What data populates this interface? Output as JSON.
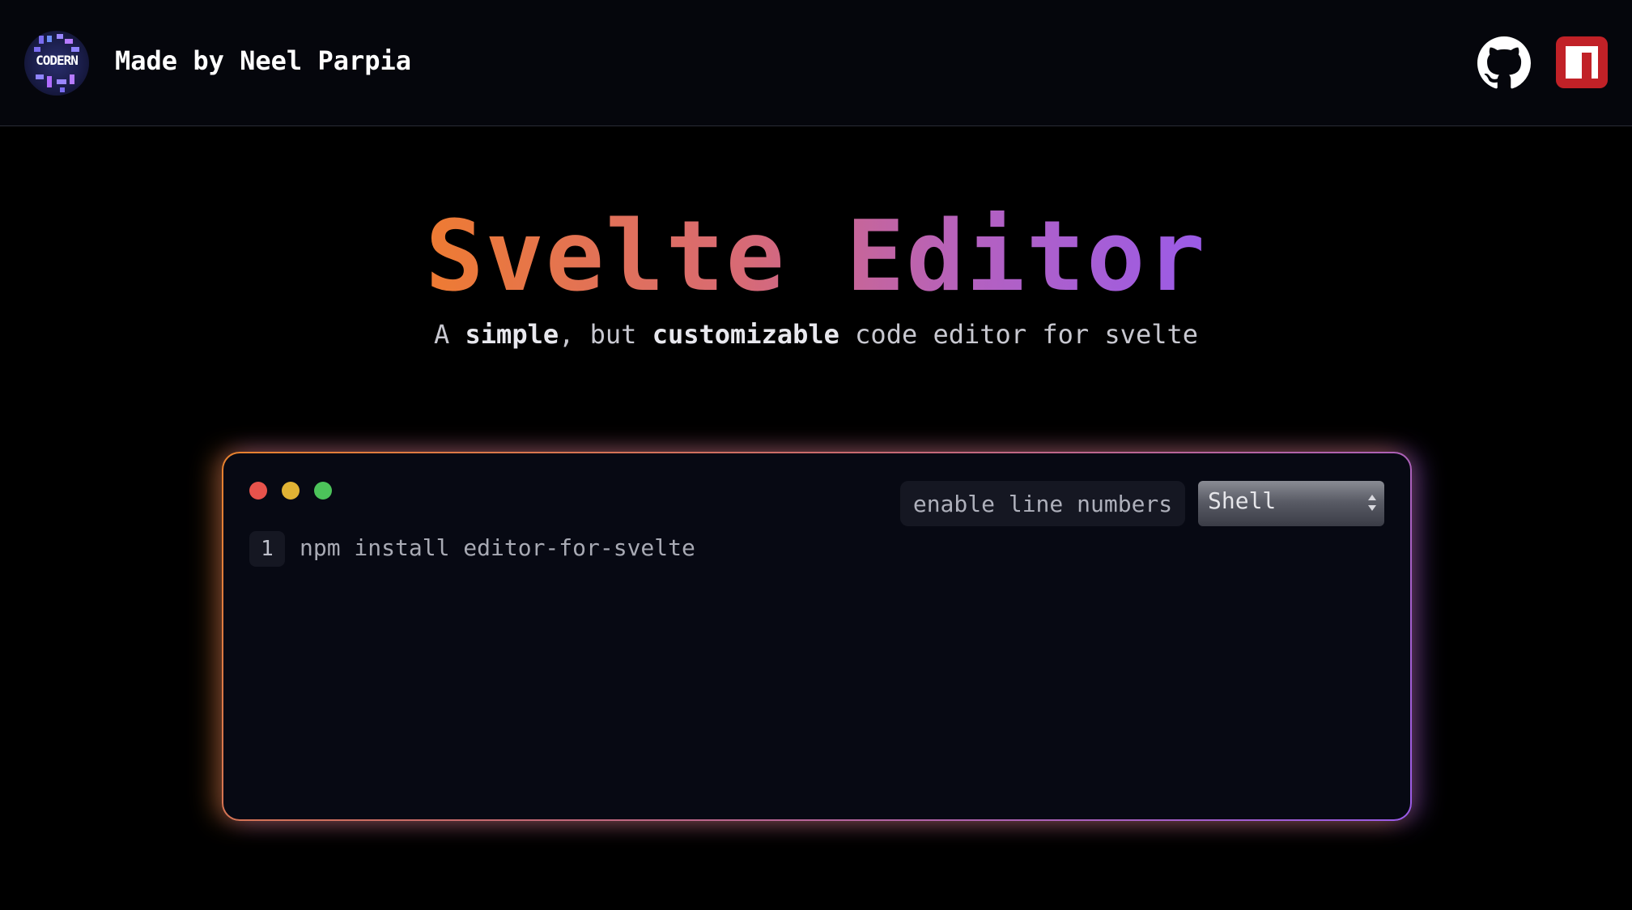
{
  "header": {
    "logo_text": "CODERN",
    "brand_name": "Made by Neel Parpia",
    "github_icon": "github-icon",
    "npm_icon": "npm-icon"
  },
  "hero": {
    "title": "Svelte Editor",
    "subtitle_parts": [
      "A ",
      "simple",
      ", but ",
      "customizable",
      " code editor for svelte"
    ]
  },
  "editor": {
    "window_dots": [
      "red",
      "yellow",
      "green"
    ],
    "line_numbers_toggle_label": "enable line numbers",
    "language_select_value": "Shell",
    "lines": [
      {
        "number": "1",
        "code": "npm install editor-for-svelte"
      }
    ]
  },
  "colors": {
    "background": "#000000",
    "header_background": "#05060c",
    "editor_background": "#070913",
    "gradient_start": "#ee7b32",
    "gradient_end": "#9a5be8",
    "npm_red": "#c12127",
    "dot_red": "#e8534c",
    "dot_yellow": "#e1b334",
    "dot_green": "#4cc35a"
  }
}
